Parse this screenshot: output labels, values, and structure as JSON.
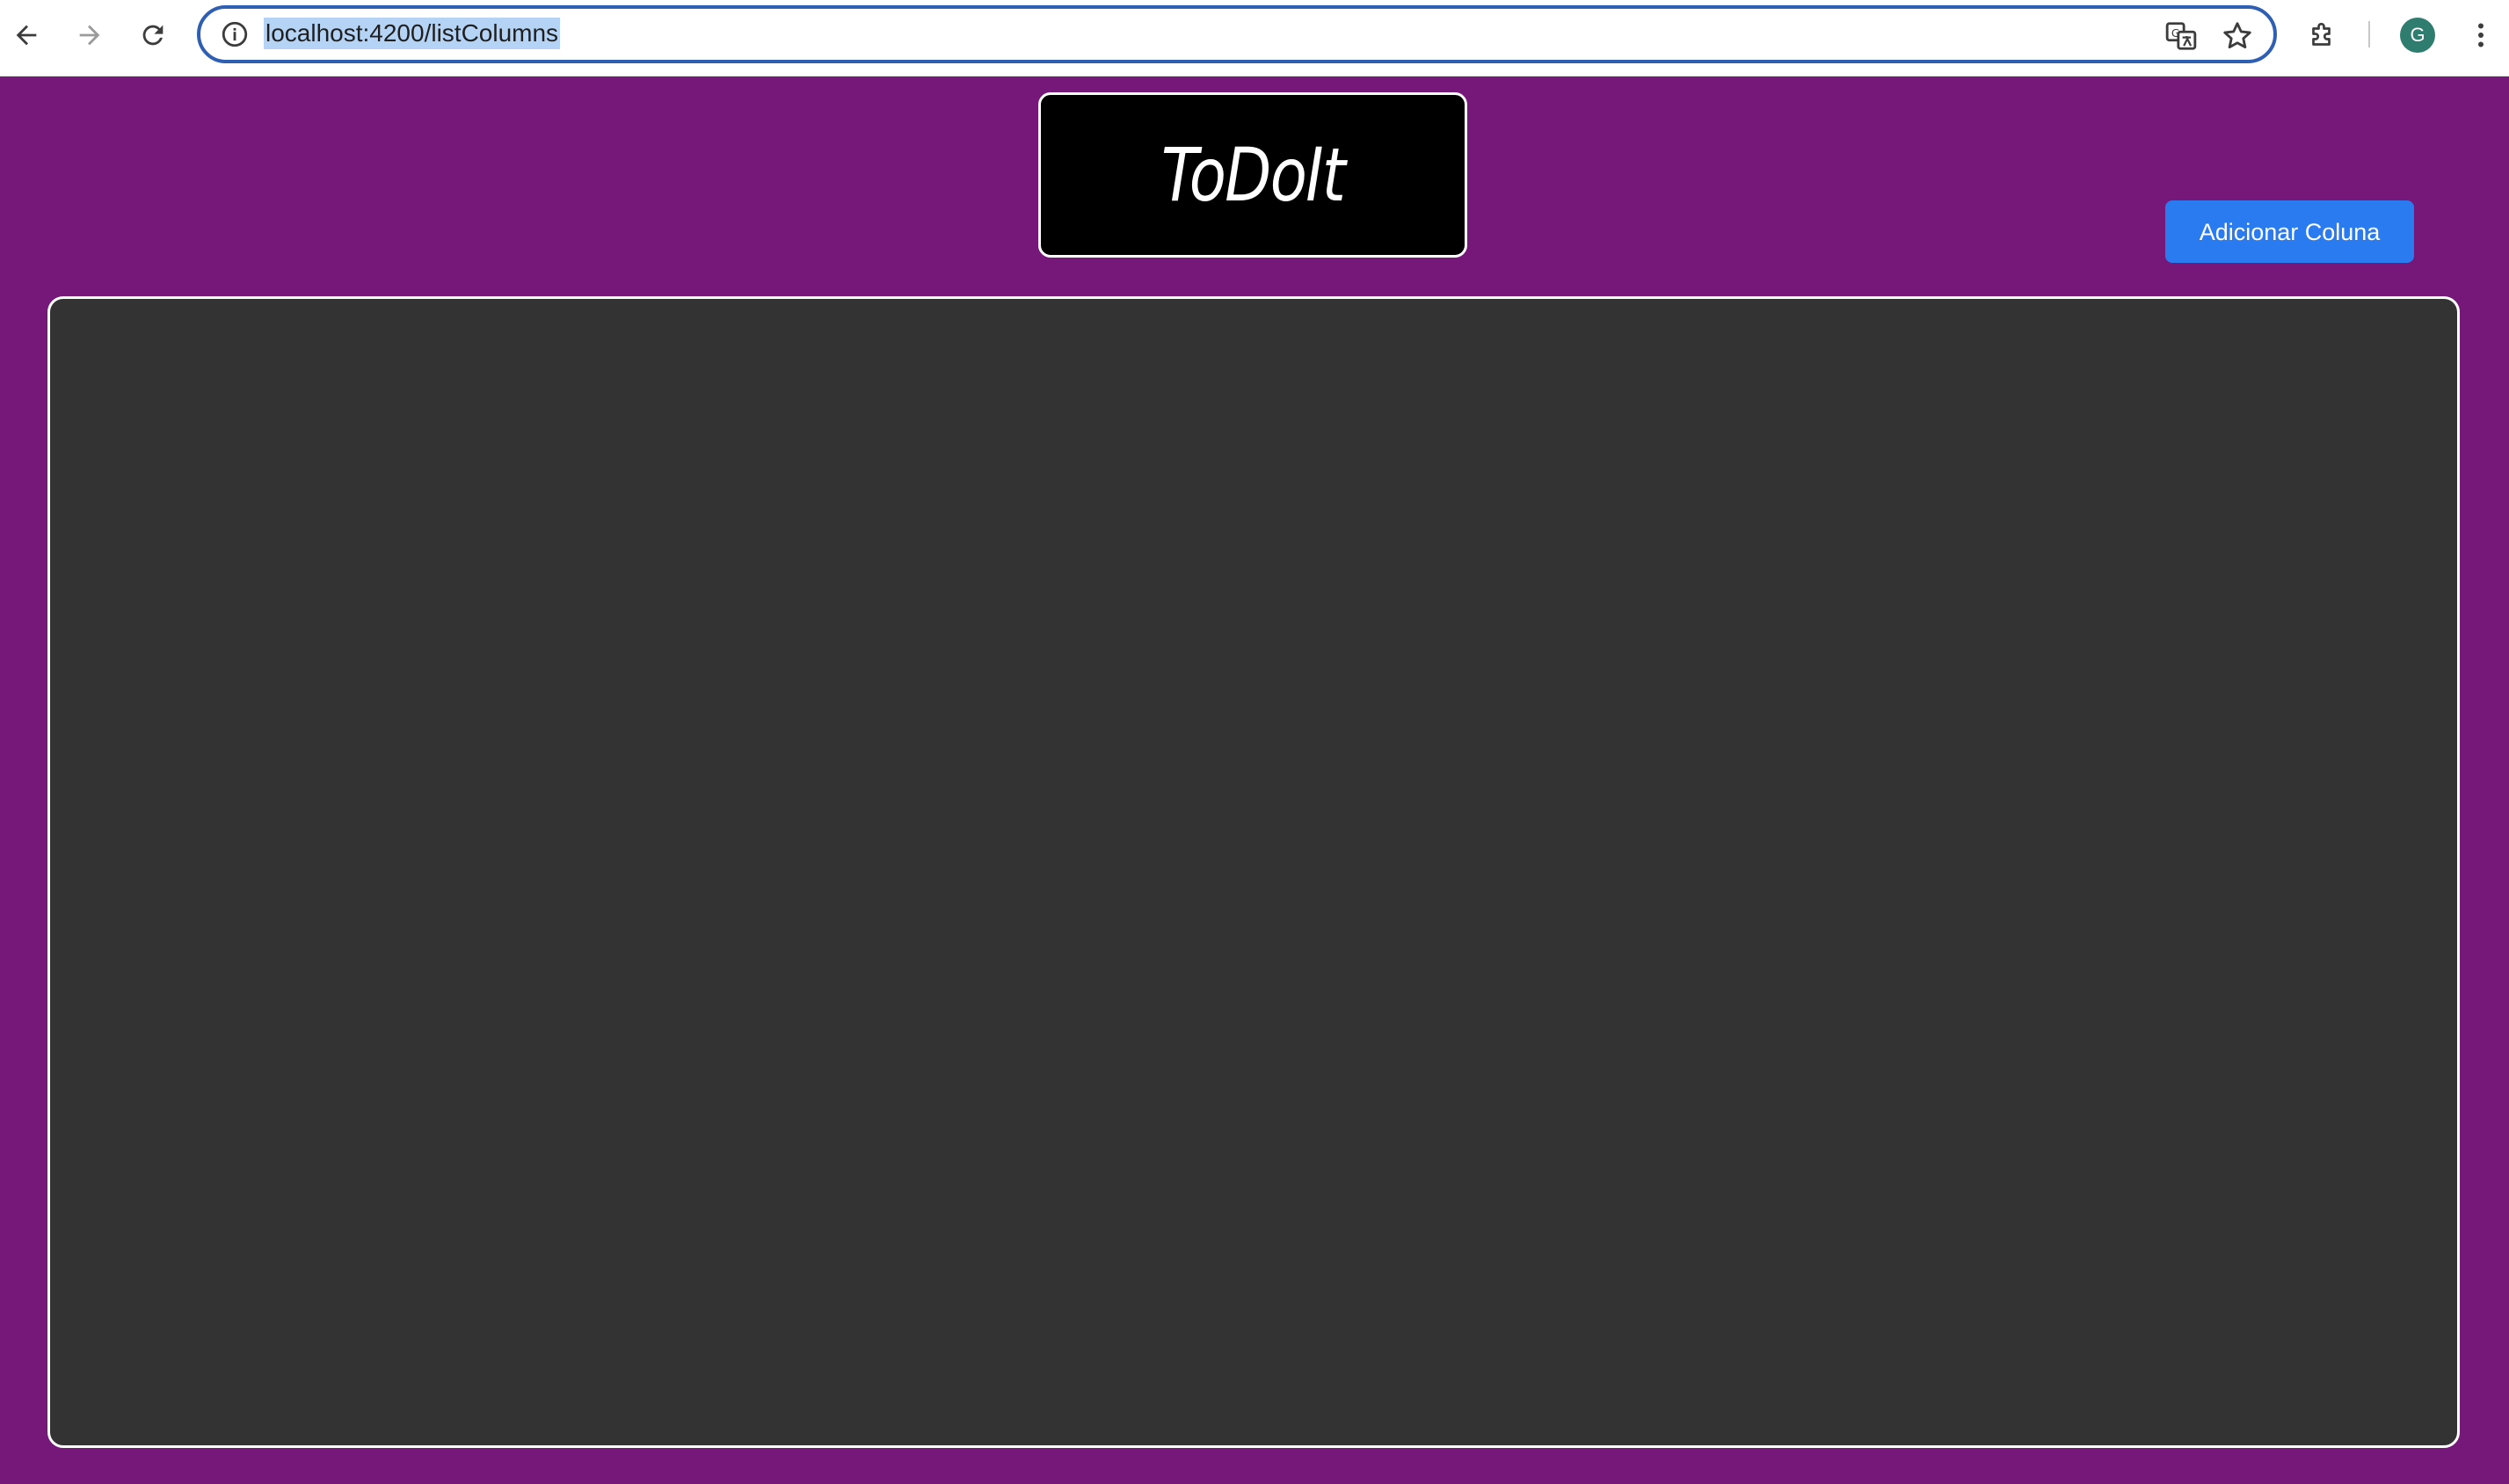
{
  "browser": {
    "url": "localhost:4200/listColumns",
    "profile_initial": "G",
    "icons": {
      "back": "arrow-left-icon",
      "forward": "arrow-right-icon",
      "reload": "reload-icon",
      "site_info": "info-icon",
      "translate": "translate-icon",
      "bookmark": "star-icon",
      "extensions": "puzzle-icon",
      "menu": "kebab-menu-icon"
    }
  },
  "app": {
    "logo_text": "ToDoIt",
    "add_column_label": "Adicionar Coluna",
    "colors": {
      "background": "#76187a",
      "board": "#333333",
      "logo_bg": "#000000",
      "button": "#2b7bf0"
    }
  }
}
